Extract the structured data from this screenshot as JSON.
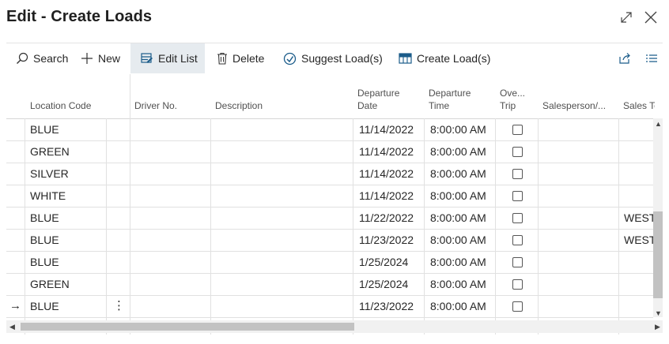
{
  "window": {
    "title": "Edit - Create Loads",
    "expand_icon": "expand-icon",
    "close_icon": "close-icon"
  },
  "toolbar": {
    "search": "Search",
    "new": "New",
    "edit_list": "Edit List",
    "delete": "Delete",
    "suggest": "Suggest Load(s)",
    "create": "Create Load(s)"
  },
  "columns": {
    "location_code": "Location Code",
    "driver_no": "Driver No.",
    "description": "Description",
    "departure_date_1": "Departure",
    "departure_date_2": "Date",
    "departure_time_1": "Departure",
    "departure_time_2": "Time",
    "ove_1": "Ove...",
    "ove_2": "Trip",
    "salesperson": "Salesperson/...",
    "sales_territory": "Sales Terri"
  },
  "rows": [
    {
      "location": "BLUE",
      "date": "11/14/2022",
      "time": "8:00:00 AM",
      "territory": "",
      "checked": false
    },
    {
      "location": "GREEN",
      "date": "11/14/2022",
      "time": "8:00:00 AM",
      "territory": "",
      "checked": false
    },
    {
      "location": "SILVER",
      "date": "11/14/2022",
      "time": "8:00:00 AM",
      "territory": "",
      "checked": false
    },
    {
      "location": "WHITE",
      "date": "11/14/2022",
      "time": "8:00:00 AM",
      "territory": "",
      "checked": false
    },
    {
      "location": "BLUE",
      "date": "11/22/2022",
      "time": "8:00:00 AM",
      "territory": "WEST",
      "checked": false
    },
    {
      "location": "BLUE",
      "date": "11/23/2022",
      "time": "8:00:00 AM",
      "territory": "WEST",
      "checked": false
    },
    {
      "location": "BLUE",
      "date": "1/25/2024",
      "time": "8:00:00 AM",
      "territory": "",
      "checked": false
    },
    {
      "location": "GREEN",
      "date": "1/25/2024",
      "time": "8:00:00 AM",
      "territory": "",
      "checked": false
    },
    {
      "location": "BLUE",
      "date": "11/23/2022",
      "time": "8:00:00 AM",
      "territory": "",
      "checked": false,
      "current": true
    }
  ]
}
